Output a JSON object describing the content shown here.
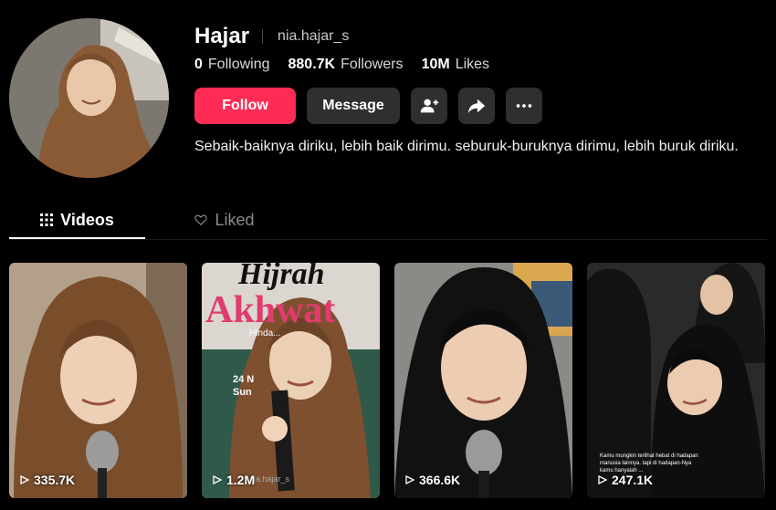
{
  "profile": {
    "display_name": "Hajar",
    "username": "nia.hajar_s",
    "stats": [
      {
        "value": "0",
        "label": "Following"
      },
      {
        "value": "880.7K",
        "label": "Followers"
      },
      {
        "value": "10M",
        "label": "Likes"
      }
    ],
    "bio": "Sebaik-baiknya diriku, lebih baik dirimu. seburuk-buruknya dirimu, lebih buruk diriku.",
    "avatar_icon": "avatar-photo"
  },
  "actions": {
    "follow_label": "Follow",
    "message_label": "Message",
    "add_friend_icon": "person-add-icon",
    "share_icon": "share-icon",
    "more_icon": "more-icon"
  },
  "tabs": [
    {
      "label": "Videos",
      "icon": "grid-icon",
      "active": true
    },
    {
      "label": "Liked",
      "icon": "heart-icon",
      "active": false
    }
  ],
  "videos": [
    {
      "views": "335.7K"
    },
    {
      "views": "1.2M",
      "overlay": {
        "line1": "Hijrah",
        "line2": "Akhwat",
        "line3": "Hinda...",
        "line4": "24 N",
        "line5": "Sun",
        "handle": "nia.hajar_s"
      }
    },
    {
      "views": "366.6K"
    },
    {
      "views": "247.1K",
      "caption": "Kamu mungkin terlihat hebat di hadapan manusia lainnya. tapi di hadapan-Nya kamu hanyalah ..."
    }
  ],
  "colors": {
    "accent": "#fe2c55",
    "background": "#000000",
    "secondary_button": "#2f2f2f"
  }
}
